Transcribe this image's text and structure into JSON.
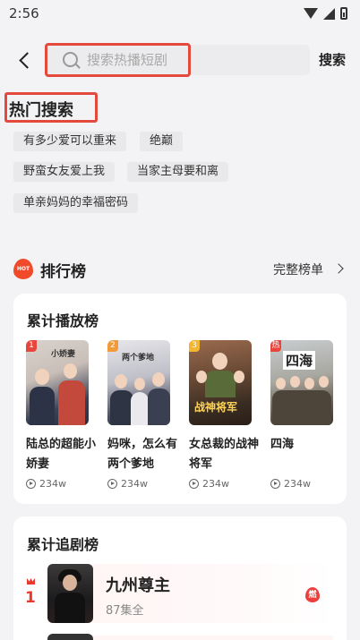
{
  "status": {
    "time": "2:56"
  },
  "search": {
    "placeholder": "搜索热播短剧",
    "button_label": "搜索"
  },
  "hot_search": {
    "title": "热门搜索",
    "tags": [
      "有多少爱可以重来",
      "绝巅",
      "野蛮女友爱上我",
      "当家主母要和离",
      "单亲妈妈的幸福密码"
    ]
  },
  "ranking": {
    "title": "排行榜",
    "hot_badge": "HOT",
    "full_list_label": "完整榜单",
    "cumulative_play": {
      "title": "累计播放榜",
      "items": [
        {
          "rank": "1",
          "title": "陆总的超能小娇妻",
          "plays": "234w",
          "badge_color": "#e8453c",
          "poster_text": "小娇妻"
        },
        {
          "rank": "2",
          "title": "妈咪，怎么有两个爹地",
          "plays": "234w",
          "badge_color": "#f29a3a",
          "poster_text": "两个爹地"
        },
        {
          "rank": "3",
          "title": "女总裁的战神将军",
          "plays": "234w",
          "badge_color": "#f2b632",
          "poster_text": "战神将军"
        },
        {
          "rank": "热",
          "title": "四海",
          "plays": "234w",
          "badge_color": "#e8453c",
          "poster_text": "四海"
        }
      ]
    },
    "cumulative_follow": {
      "title": "累计追剧榜",
      "items": [
        {
          "rank": "1",
          "title": "九州尊主",
          "subtitle": "87集全",
          "fire_badge": "燃"
        }
      ]
    }
  },
  "colors": {
    "accent_red": "#e34a3b",
    "rank_red": "#e83a2c"
  }
}
